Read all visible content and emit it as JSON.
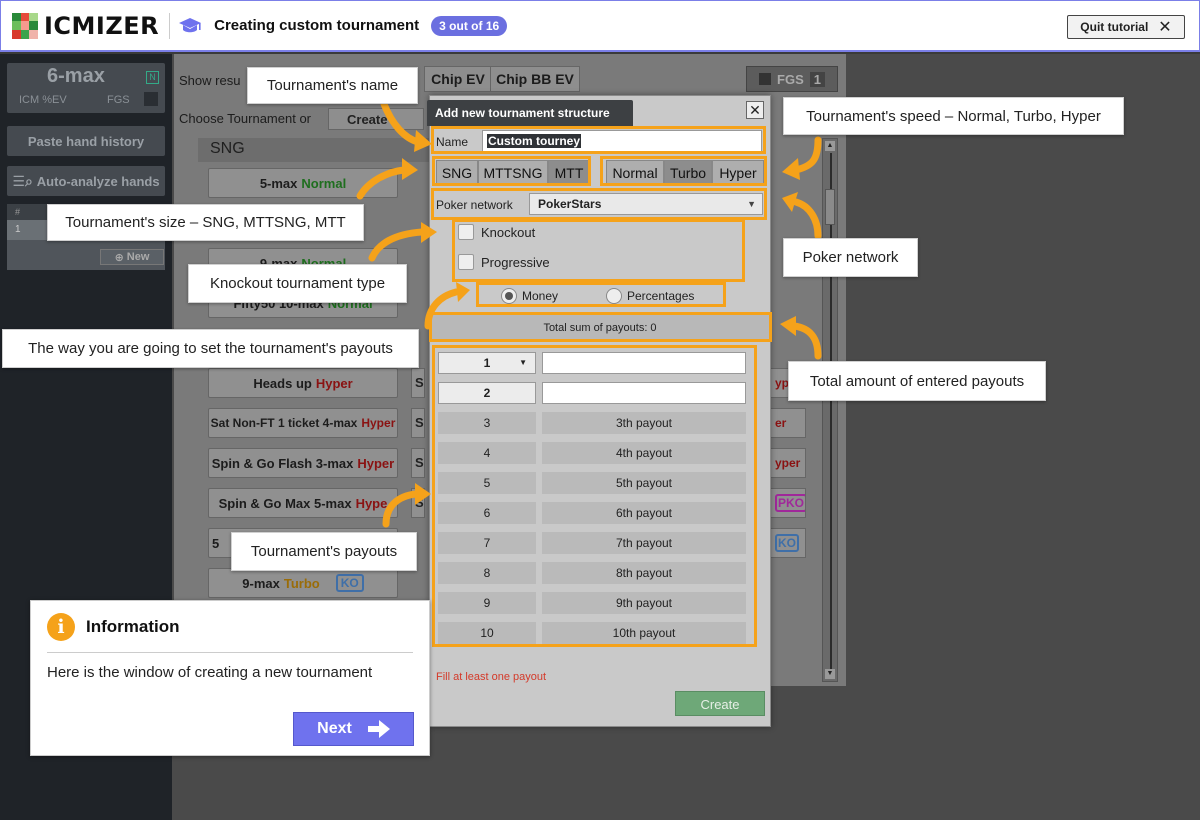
{
  "header": {
    "logo_text": "ICMIZER",
    "title": "Creating custom tournament",
    "step": "3 out of 16",
    "quit_label": "Quit tutorial"
  },
  "sidebar": {
    "max_title": "6-max",
    "n_badge": "N",
    "icm_label": "ICM %EV",
    "fgs_label": "FGS",
    "paste_label": "Paste hand history",
    "auto_label": "Auto-analyze hands",
    "table_header": "#",
    "row_num": "1",
    "new_label": "New"
  },
  "background": {
    "show_results_label": "Show resu",
    "chip_ev": "Chip EV",
    "chip_bb_ev": "Chip BB EV",
    "fgs_label": "FGS",
    "fgs_value": "1",
    "choose_label": "Choose Tournament or",
    "create_label": "Create",
    "sng_heading": "SNG",
    "buttons": [
      {
        "name": "5-max",
        "speed": "Normal",
        "speed_class": "green",
        "badge": ""
      },
      {
        "name": "9-max",
        "speed": "Normal",
        "speed_class": "green",
        "badge": ""
      },
      {
        "name": "Fifty50 10-max",
        "speed": "Normal",
        "speed_class": "green",
        "badge": ""
      },
      {
        "name": "Heads up",
        "speed": "Hyper",
        "speed_class": "red",
        "badge": ""
      },
      {
        "name": "Sat Non-FT 1 ticket 4-max",
        "speed": "Hyper",
        "speed_class": "red",
        "badge": ""
      },
      {
        "name": "Spin & Go Flash 3-max",
        "speed": "Hyper",
        "speed_class": "red",
        "badge": ""
      },
      {
        "name": "Spin & Go Max 5-max",
        "speed": "Hype",
        "speed_class": "red",
        "badge": ""
      },
      {
        "name": "5",
        "speed": "",
        "speed_class": "",
        "badge": ""
      },
      {
        "name": "9-max",
        "speed": "Turbo",
        "speed_class": "orange",
        "badge": "KO"
      }
    ],
    "right_fragments": [
      "yp",
      "er",
      "yper",
      "PKO",
      "KO"
    ],
    "left_fragments": [
      "S",
      "S",
      "Sp",
      "Sp"
    ]
  },
  "dialog": {
    "title": "Add new tournament structure",
    "name_label": "Name",
    "name_value": "Custom tourney",
    "size_options": [
      "SNG",
      "MTTSNG",
      "MTT"
    ],
    "speed_options": [
      "Normal",
      "Turbo",
      "Hyper"
    ],
    "network_label": "Poker network",
    "network_value": "PokerStars",
    "knockout_label": "Knockout",
    "progressive_label": "Progressive",
    "money_label": "Money",
    "percentages_label": "Percentages",
    "total_label": "Total sum of payouts: 0",
    "payouts": [
      {
        "place": "1",
        "label": ""
      },
      {
        "place": "2",
        "label": ""
      },
      {
        "place": "3",
        "label": "3th payout"
      },
      {
        "place": "4",
        "label": "4th payout"
      },
      {
        "place": "5",
        "label": "5th payout"
      },
      {
        "place": "6",
        "label": "6th payout"
      },
      {
        "place": "7",
        "label": "7th payout"
      },
      {
        "place": "8",
        "label": "8th payout"
      },
      {
        "place": "9",
        "label": "9th payout"
      },
      {
        "place": "10",
        "label": "10th payout"
      }
    ],
    "fill_message": "Fill at least one payout",
    "create_label": "Create"
  },
  "callouts": {
    "name": "Tournament's name",
    "speed": "Tournament's speed – Normal, Turbo, Hyper",
    "size": "Tournament's size – SNG, MTTSNG, MTT",
    "network": "Poker network",
    "knockout": "Knockout tournament type",
    "payout_way": "The way you are going to set the tournament's payouts",
    "total": "Total amount of entered payouts",
    "payouts": "Tournament's payouts"
  },
  "info": {
    "icon": "i",
    "title": "Information",
    "text": "Here is the window of creating a new tournament",
    "next_label": "Next"
  },
  "colors": {
    "accent": "#6f72ee",
    "highlight": "#f5a21a",
    "error": "#d43a2a",
    "create_green": "#6ea878"
  }
}
